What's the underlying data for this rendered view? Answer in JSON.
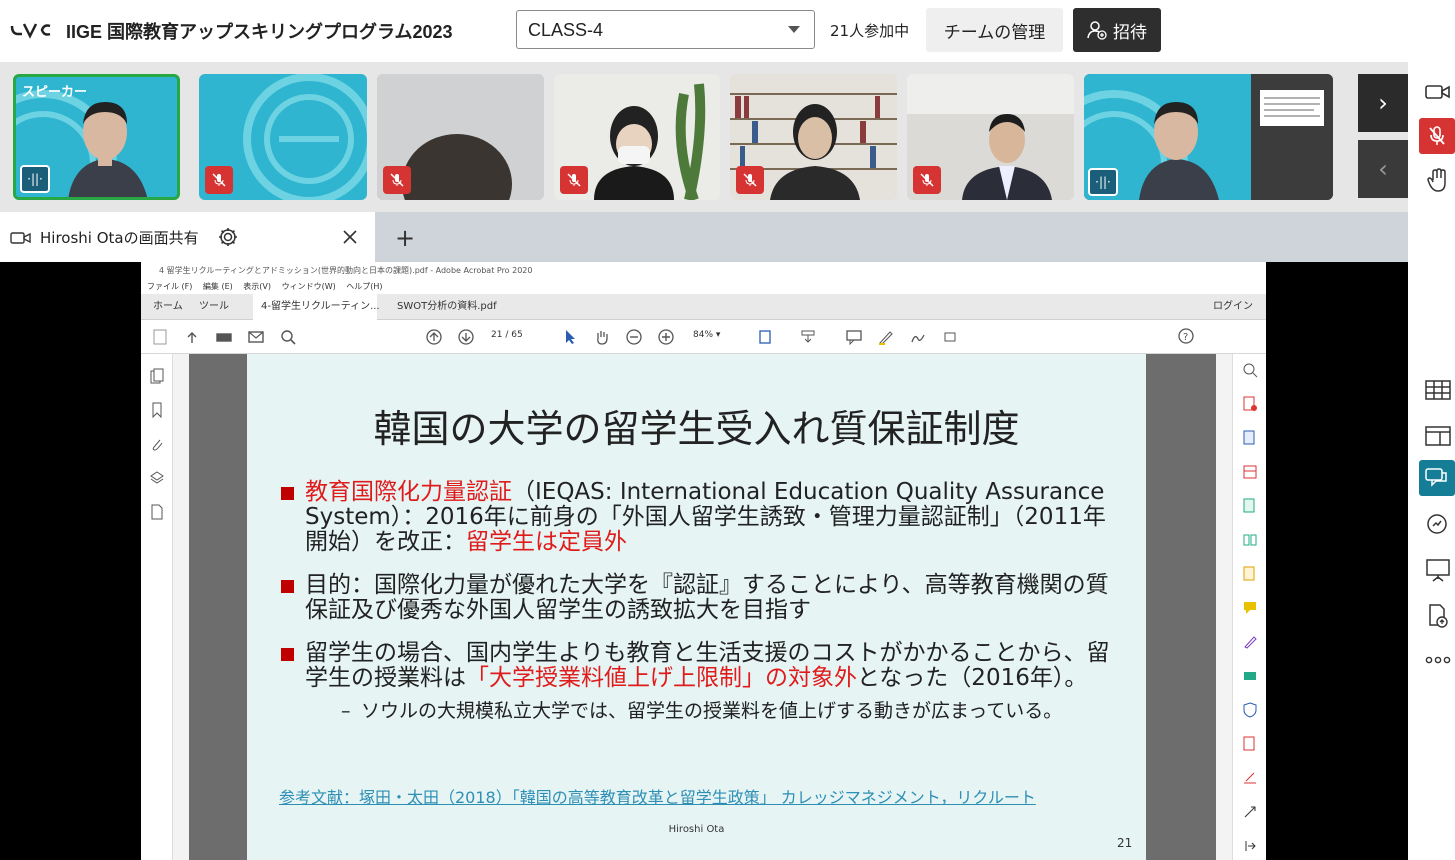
{
  "header": {
    "app_title": "IIGE 国際教育アップスキリングプログラム2023",
    "class_select": "CLASS-4",
    "participants": "21人参加中",
    "team_button": "チームの管理",
    "invite_button": "招待"
  },
  "video_strip": {
    "speaker_label": "スピーカー",
    "tiles": [
      "speaker",
      "avatar",
      "participant",
      "participant",
      "participant",
      "participant",
      "speaker-self"
    ]
  },
  "share_tab": {
    "title": "Hiroshi Otaの画面共有",
    "add": "+"
  },
  "acrobat": {
    "window_title": "4 留学生リクルーティングとアドミッション(世界的動向と日本の課題).pdf - Adobe Acrobat Pro 2020",
    "menu": "ファイル (F)　 編集 (E)　 表示(V)　 ウィンドウ(W)　 ヘルプ(H)",
    "tabs": [
      "ホーム",
      "ツール",
      "4-留学生リクルーティン...",
      "SWOT分析の資料.pdf"
    ],
    "login": "ログイン",
    "page_current": "21",
    "page_total": "/ 65",
    "zoom": "84%"
  },
  "slide": {
    "title": "韓国の大学の留学生受入れ質保証制度",
    "b1_red1": "教育国際化力量認証",
    "b1_text": "（IEQAS: International Education Quality Assurance System）：2016年に前身の「外国人留学生誘致・管理力量認証制」（2011年開始）を改正：",
    "b1_red2": "留学生は定員外",
    "b2_text": "目的：国際化力量が優れた大学を『認証』することにより、高等教育機関の質保証及び優秀な外国人留学生の誘致拡大を目指す",
    "b3_text1": "留学生の場合、国内学生よりも教育と生活支援のコストがかかることから、留学生の授業料は",
    "b3_red": "「大学授業料値上げ上限制」の対象外",
    "b3_text2": "となった（2016年）。",
    "sub": "ソウルの大規模私立大学では、留学生の授業料を値上げする動きが広まっている。",
    "reference": "参考文献：塚田・太田（2018）「韓国の高等教育改革と留学生政策」 カレッジマネジメント，リクルート",
    "author": "Hiroshi Ota",
    "page_number": "21"
  }
}
